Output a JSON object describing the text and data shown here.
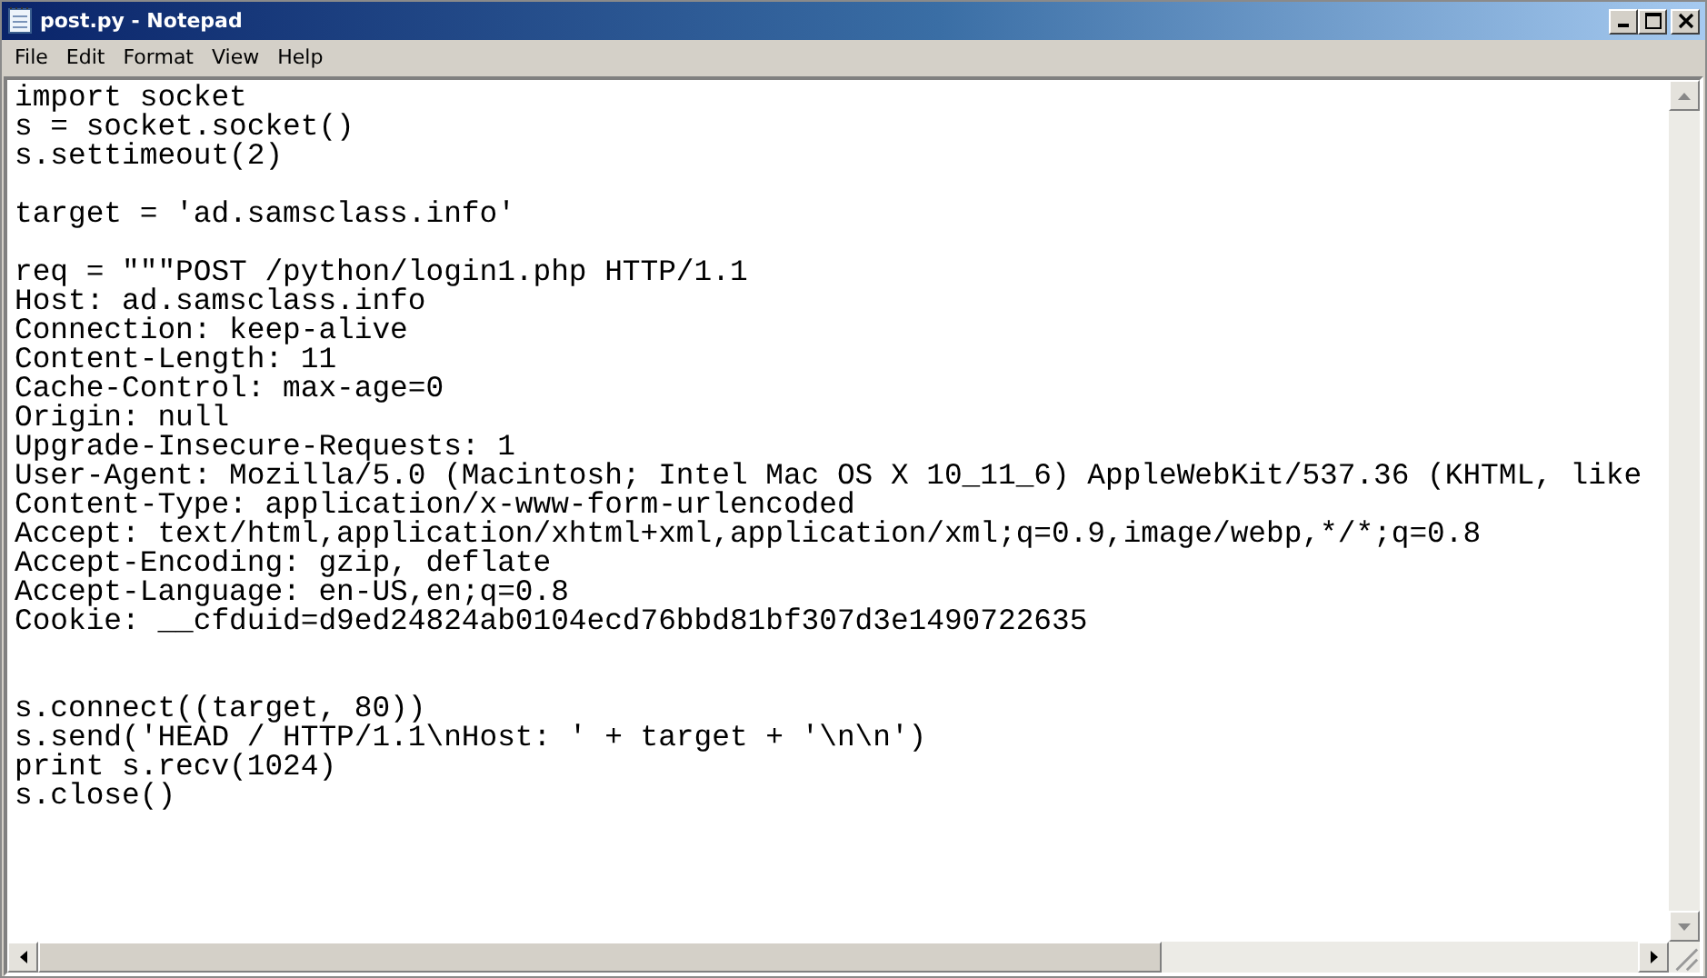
{
  "window": {
    "title": "post.py - Notepad"
  },
  "menu": [
    "File",
    "Edit",
    "Format",
    "View",
    "Help"
  ],
  "lines": [
    {
      "kind": "code",
      "text": "import socket"
    },
    {
      "kind": "code",
      "text": "s = socket.socket()"
    },
    {
      "kind": "code",
      "text": "s.settimeout(2)"
    },
    {
      "kind": "blank"
    },
    {
      "kind": "code",
      "text": "target = 'ad.samsclass.info'"
    },
    {
      "kind": "blank"
    },
    {
      "kind": "code",
      "text": "req = \"\"\"POST /python/login1.php HTTP/1.1"
    },
    {
      "kind": "code",
      "text": "Host: ad.samsclass.info"
    },
    {
      "kind": "code",
      "text": "Connection: keep-alive"
    },
    {
      "kind": "code",
      "text": "Content-Length: 11"
    },
    {
      "kind": "code",
      "text": "Cache-Control: max-age=0"
    },
    {
      "kind": "code",
      "text": "Origin: null"
    },
    {
      "kind": "code",
      "text": "Upgrade-Insecure-Requests: 1"
    },
    {
      "kind": "code",
      "text": "User-Agent: Mozilla/5.0 (Macintosh; Intel Mac OS X 10_11_6) AppleWebKit/537.36 (KHTML, like"
    },
    {
      "kind": "code",
      "text": "Content-Type: application/x-www-form-urlencoded"
    },
    {
      "kind": "code",
      "text": "Accept: text/html,application/xhtml+xml,application/xml;q=0.9,image/webp,*/*;q=0.8"
    },
    {
      "kind": "code",
      "text": "Accept-Encoding: gzip, deflate"
    },
    {
      "kind": "code",
      "text": "Accept-Language: en-US,en;q=0.8"
    },
    {
      "kind": "code",
      "text": "Cookie: __cfduid=d9ed24824ab0104ecd76bbd81bf307d3e1490722635"
    },
    {
      "kind": "blank"
    },
    {
      "kind": "blank"
    },
    {
      "kind": "code",
      "text": "s.connect((target, 80))"
    },
    {
      "kind": "code",
      "text": "s.send('HEAD / HTTP/1.1\\nHost: ' + target + '\\n\\n')"
    },
    {
      "kind": "code",
      "text": "print s.recv(1024)"
    },
    {
      "kind": "code",
      "text": "s.close()"
    }
  ]
}
